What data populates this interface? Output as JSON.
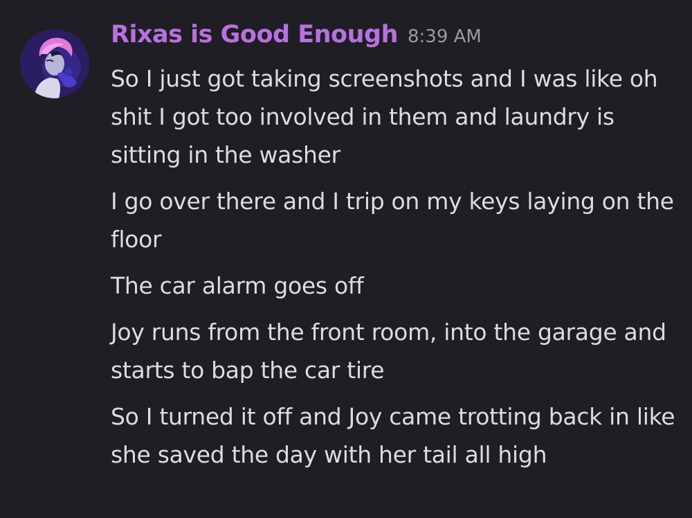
{
  "author": {
    "name": "Rixas is Good Enough",
    "timestamp": "8:39 AM",
    "name_color": "#b870e0",
    "avatar_icon": "user-avatar-icon"
  },
  "messages": [
    "So I just got taking screenshots and I was like oh shit I got too involved in them and laundry is sitting in the washer",
    "I go over there and I trip on my keys laying on the floor",
    "The car alarm goes off",
    "Joy runs from the front room, into the garage and starts to bap the car tire",
    "So I turned it off and Joy came trotting back in like she saved the day with her tail all high"
  ],
  "colors": {
    "background": "#1e1e24",
    "text": "#dcdce2",
    "timestamp": "#9a9aa3"
  }
}
